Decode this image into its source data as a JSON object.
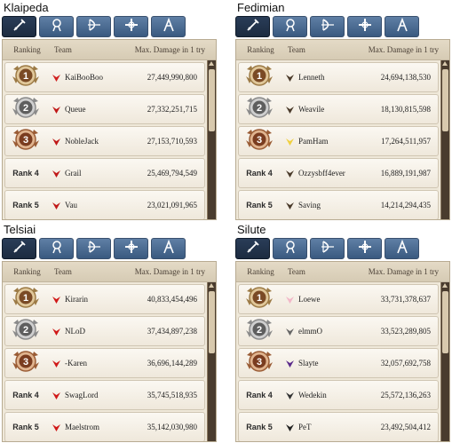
{
  "tab_icons": [
    "sword-icon",
    "mage-icon",
    "bow-icon",
    "cleric-icon",
    "scout-icon"
  ],
  "header": {
    "ranking": "Ranking",
    "team": "Team",
    "damage": "Max. Damage in 1 try"
  },
  "colors": {
    "tab_active": "#1f2f46",
    "tab": "#4c6a90",
    "panel": "#efe8d9",
    "scroll": "#4a3c2e"
  },
  "quadrants": [
    {
      "server": "Klaipeda",
      "rows": [
        {
          "rank": "1",
          "team": "KaiBooBoo",
          "damage": "27,449,990,800",
          "icon": "santa-icon"
        },
        {
          "rank": "2",
          "team": "Queue",
          "damage": "27,332,251,715",
          "icon": "demon-icon"
        },
        {
          "rank": "3",
          "team": "NobleJack",
          "damage": "27,153,710,593",
          "icon": "demon-icon"
        },
        {
          "rank": "Rank 4",
          "team": "Grail",
          "damage": "25,469,794,549",
          "icon": "demon-icon"
        },
        {
          "rank": "Rank 5",
          "team": "Vau",
          "damage": "23,021,091,965",
          "icon": "demon-icon"
        }
      ]
    },
    {
      "server": "Fedimian",
      "rows": [
        {
          "rank": "1",
          "team": "Lenneth",
          "damage": "24,694,138,530",
          "icon": "wing-icon"
        },
        {
          "rank": "2",
          "team": "Weavile",
          "damage": "18,130,815,598",
          "icon": "wing-icon"
        },
        {
          "rank": "3",
          "team": "PamHam",
          "damage": "17,264,511,957",
          "icon": "chick-icon"
        },
        {
          "rank": "Rank 4",
          "team": "Ozzysbff4ever",
          "damage": "16,889,191,987",
          "icon": "wing-icon"
        },
        {
          "rank": "Rank 5",
          "team": "Saving",
          "damage": "14,214,294,435",
          "icon": "wing-icon"
        }
      ]
    },
    {
      "server": "Telsiai",
      "rows": [
        {
          "rank": "1",
          "team": "Kirarin",
          "damage": "40,833,454,496",
          "icon": "red-wing-icon"
        },
        {
          "rank": "2",
          "team": "NLoD",
          "damage": "37,434,897,238",
          "icon": "red-wing-icon"
        },
        {
          "rank": "3",
          "team": "-Karen",
          "damage": "36,696,144,289",
          "icon": "red-wing-icon"
        },
        {
          "rank": "Rank 4",
          "team": "SwagLord",
          "damage": "35,745,518,935",
          "icon": "red-wing-icon"
        },
        {
          "rank": "Rank 5",
          "team": "Maelstrom",
          "damage": "35,142,030,980",
          "icon": "red-wing-icon"
        }
      ]
    },
    {
      "server": "Silute",
      "rows": [
        {
          "rank": "1",
          "team": "Loewe",
          "damage": "33,731,378,637",
          "icon": "pig-icon"
        },
        {
          "rank": "2",
          "team": "elmmO",
          "damage": "33,523,289,805",
          "icon": "ghost-icon"
        },
        {
          "rank": "3",
          "team": "Slayte",
          "damage": "32,057,692,758",
          "icon": "spider-icon"
        },
        {
          "rank": "Rank 4",
          "team": "Wedekin",
          "damage": "25,572,136,263",
          "icon": "horns-icon"
        },
        {
          "rank": "Rank 5",
          "team": "PeT",
          "damage": "23,492,504,412",
          "icon": "hat-icon"
        }
      ]
    }
  ]
}
